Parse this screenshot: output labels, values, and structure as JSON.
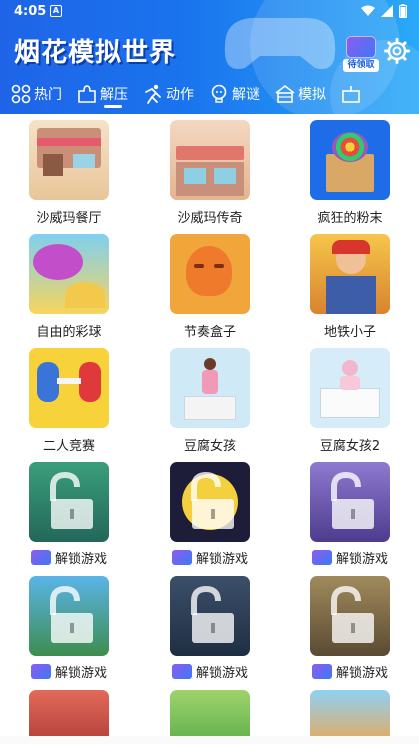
{
  "status_bar": {
    "time": "4:05",
    "notification_glyph": "A"
  },
  "header": {
    "title": "烟花模拟世界",
    "reward_label": "待领取",
    "colors": {
      "header_start": "#1f64e7",
      "header_end": "#2aa9f7"
    }
  },
  "tabs": [
    {
      "label": "热门",
      "icon": "puzzle-grid-icon",
      "active": false
    },
    {
      "label": "解压",
      "icon": "puzzle-piece-icon",
      "active": true
    },
    {
      "label": "动作",
      "icon": "running-figure-icon",
      "active": false
    },
    {
      "label": "解谜",
      "icon": "lightbulb-icon",
      "active": false
    },
    {
      "label": "模拟",
      "icon": "building-icon",
      "active": false
    }
  ],
  "games": [
    {
      "label": "沙威玛餐厅",
      "locked": false
    },
    {
      "label": "沙威玛传奇",
      "locked": false
    },
    {
      "label": "疯狂的粉末",
      "locked": false
    },
    {
      "label": "自由的彩球",
      "locked": false
    },
    {
      "label": "节奏盒子",
      "locked": false
    },
    {
      "label": "地铁小子",
      "locked": false
    },
    {
      "label": "二人竞赛",
      "locked": false
    },
    {
      "label": "豆腐女孩",
      "locked": false
    },
    {
      "label": "豆腐女孩2",
      "locked": false
    },
    {
      "label": "解锁游戏",
      "locked": true
    },
    {
      "label": "解锁游戏",
      "locked": true
    },
    {
      "label": "解锁游戏",
      "locked": true
    },
    {
      "label": "解锁游戏",
      "locked": true
    },
    {
      "label": "解锁游戏",
      "locked": true
    },
    {
      "label": "解锁游戏",
      "locked": true
    },
    {
      "label": "",
      "locked": false
    },
    {
      "label": "",
      "locked": false
    },
    {
      "label": "",
      "locked": false
    }
  ]
}
